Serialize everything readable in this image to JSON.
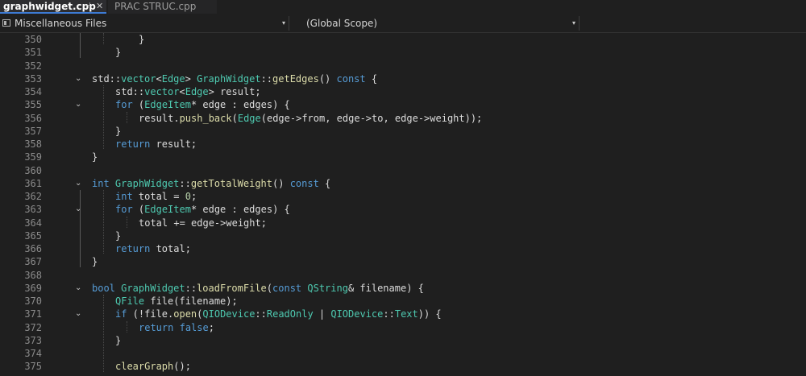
{
  "tabs": [
    {
      "label": "graphwidget.cpp",
      "active": true,
      "pin_glyph": "⊣",
      "close_glyph": "✕"
    },
    {
      "label": "PRAC STRUC.cpp",
      "active": false
    }
  ],
  "navbar": {
    "files_label": "Miscellaneous Files",
    "scope_label": "(Global Scope)",
    "dropdown_glyph": "▾",
    "file_icon": "project-icon"
  },
  "colors": {
    "background": "#1f1f1f",
    "keyword": "#569cd6",
    "type": "#4ec9b0",
    "function": "#dcdcaa",
    "number": "#b5cea8",
    "text": "#dcdcdc",
    "line_number": "#8a8a8a",
    "active_tab_accent": "#3d7bd4"
  },
  "editor": {
    "fold_glyph": "⌄",
    "lines": [
      {
        "n": "350",
        "fold": false,
        "indent": 2,
        "tokens": [
          [
            "t",
            "}"
          ]
        ]
      },
      {
        "n": "351",
        "fold": false,
        "indent": 1,
        "tokens": [
          [
            "t",
            "}"
          ]
        ]
      },
      {
        "n": "352",
        "fold": false,
        "indent": 0,
        "tokens": []
      },
      {
        "n": "353",
        "fold": true,
        "indent": 0,
        "tokens": [
          [
            "t",
            "std::"
          ],
          [
            "ty",
            "vector"
          ],
          [
            "t",
            "<"
          ],
          [
            "ty",
            "Edge"
          ],
          [
            "t",
            "> "
          ],
          [
            "ty",
            "GraphWidget"
          ],
          [
            "t",
            "::"
          ],
          [
            "fn",
            "getEdges"
          ],
          [
            "t",
            "() "
          ],
          [
            "kw",
            "const"
          ],
          [
            "t",
            " {"
          ]
        ]
      },
      {
        "n": "354",
        "fold": false,
        "indent": 1,
        "tokens": [
          [
            "t",
            "std::"
          ],
          [
            "ty",
            "vector"
          ],
          [
            "t",
            "<"
          ],
          [
            "ty",
            "Edge"
          ],
          [
            "t",
            "> result;"
          ]
        ]
      },
      {
        "n": "355",
        "fold": true,
        "indent": 1,
        "tokens": [
          [
            "kw",
            "for"
          ],
          [
            "t",
            " ("
          ],
          [
            "ty",
            "EdgeItem"
          ],
          [
            "t",
            "* edge : edges) {"
          ]
        ]
      },
      {
        "n": "356",
        "fold": false,
        "indent": 2,
        "tokens": [
          [
            "t",
            "result."
          ],
          [
            "fn",
            "push_back"
          ],
          [
            "t",
            "("
          ],
          [
            "ty",
            "Edge"
          ],
          [
            "t",
            "(edge->from, edge->to, edge->weight));"
          ]
        ]
      },
      {
        "n": "357",
        "fold": false,
        "indent": 1,
        "tokens": [
          [
            "t",
            "}"
          ]
        ]
      },
      {
        "n": "358",
        "fold": false,
        "indent": 1,
        "tokens": [
          [
            "kw",
            "return"
          ],
          [
            "t",
            " result;"
          ]
        ]
      },
      {
        "n": "359",
        "fold": false,
        "indent": 0,
        "tokens": [
          [
            "t",
            "}"
          ]
        ]
      },
      {
        "n": "360",
        "fold": false,
        "indent": 0,
        "tokens": []
      },
      {
        "n": "361",
        "fold": true,
        "indent": 0,
        "tokens": [
          [
            "kw",
            "int"
          ],
          [
            "t",
            " "
          ],
          [
            "ty",
            "GraphWidget"
          ],
          [
            "t",
            "::"
          ],
          [
            "fn",
            "getTotalWeight"
          ],
          [
            "t",
            "() "
          ],
          [
            "kw",
            "const"
          ],
          [
            "t",
            " {"
          ]
        ]
      },
      {
        "n": "362",
        "fold": false,
        "indent": 1,
        "tokens": [
          [
            "kw",
            "int"
          ],
          [
            "t",
            " total = "
          ],
          [
            "nu",
            "0"
          ],
          [
            "t",
            ";"
          ]
        ]
      },
      {
        "n": "363",
        "fold": true,
        "indent": 1,
        "tokens": [
          [
            "kw",
            "for"
          ],
          [
            "t",
            " ("
          ],
          [
            "ty",
            "EdgeItem"
          ],
          [
            "t",
            "* edge : edges) {"
          ]
        ]
      },
      {
        "n": "364",
        "fold": false,
        "indent": 2,
        "tokens": [
          [
            "t",
            "total += edge->weight;"
          ]
        ]
      },
      {
        "n": "365",
        "fold": false,
        "indent": 1,
        "tokens": [
          [
            "t",
            "}"
          ]
        ]
      },
      {
        "n": "366",
        "fold": false,
        "indent": 1,
        "tokens": [
          [
            "kw",
            "return"
          ],
          [
            "t",
            " total;"
          ]
        ]
      },
      {
        "n": "367",
        "fold": false,
        "indent": 0,
        "tokens": [
          [
            "t",
            "}"
          ]
        ]
      },
      {
        "n": "368",
        "fold": false,
        "indent": 0,
        "tokens": []
      },
      {
        "n": "369",
        "fold": true,
        "indent": 0,
        "tokens": [
          [
            "kw",
            "bool"
          ],
          [
            "t",
            " "
          ],
          [
            "ty",
            "GraphWidget"
          ],
          [
            "t",
            "::"
          ],
          [
            "fn",
            "loadFromFile"
          ],
          [
            "t",
            "("
          ],
          [
            "kw",
            "const"
          ],
          [
            "t",
            " "
          ],
          [
            "ty",
            "QString"
          ],
          [
            "t",
            "& filename) {"
          ]
        ]
      },
      {
        "n": "370",
        "fold": false,
        "indent": 1,
        "tokens": [
          [
            "ty",
            "QFile"
          ],
          [
            "t",
            " file(filename);"
          ]
        ]
      },
      {
        "n": "371",
        "fold": true,
        "indent": 1,
        "tokens": [
          [
            "kw",
            "if"
          ],
          [
            "t",
            " (!file."
          ],
          [
            "fn",
            "open"
          ],
          [
            "t",
            "("
          ],
          [
            "ty",
            "QIODevice"
          ],
          [
            "t",
            "::"
          ],
          [
            "ty",
            "ReadOnly"
          ],
          [
            "t",
            " | "
          ],
          [
            "ty",
            "QIODevice"
          ],
          [
            "t",
            "::"
          ],
          [
            "ty",
            "Text"
          ],
          [
            "t",
            ")) {"
          ]
        ]
      },
      {
        "n": "372",
        "fold": false,
        "indent": 2,
        "tokens": [
          [
            "kw",
            "return"
          ],
          [
            "t",
            " "
          ],
          [
            "kw",
            "false"
          ],
          [
            "t",
            ";"
          ]
        ]
      },
      {
        "n": "373",
        "fold": false,
        "indent": 1,
        "tokens": [
          [
            "t",
            "}"
          ]
        ]
      },
      {
        "n": "374",
        "fold": false,
        "indent": 0,
        "tokens": []
      },
      {
        "n": "375",
        "fold": false,
        "indent": 1,
        "tokens": [
          [
            "fn",
            "clearGraph"
          ],
          [
            "t",
            "();"
          ]
        ]
      }
    ]
  }
}
